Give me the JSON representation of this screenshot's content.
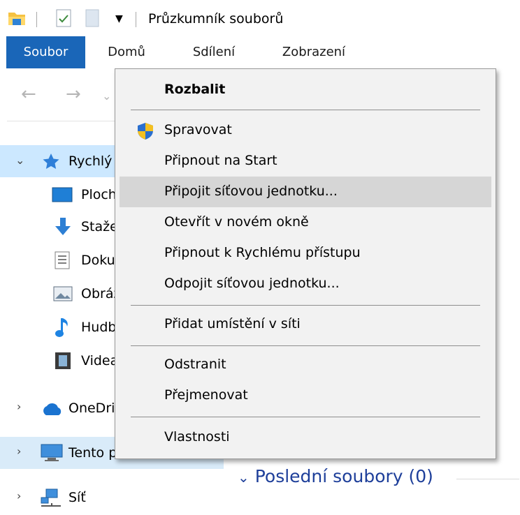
{
  "window": {
    "title": "Průzkumník souborů"
  },
  "ribbon": {
    "tabs": [
      "Soubor",
      "Domů",
      "Sdílení",
      "Zobrazení"
    ]
  },
  "sidebar": {
    "quick_access": "Rychlý přístup",
    "items": [
      "Plocha",
      "Stažené soubory",
      "Dokumenty",
      "Obrázky",
      "Hudba",
      "Videa"
    ],
    "onedrive": "OneDrive",
    "this_pc": "Tento počítač",
    "network": "Síť"
  },
  "content": {
    "recent_header": "Poslední soubory (0)"
  },
  "context_menu": {
    "items": [
      "Rozbalit",
      "Spravovat",
      "Připnout na Start",
      "Připojit síťovou jednotku...",
      "Otevřít v novém okně",
      "Připnout k Rychlému přístupu",
      "Odpojit síťovou jednotku...",
      "Přidat umístění v síti",
      "Odstranit",
      "Přejmenovat",
      "Vlastnosti"
    ],
    "highlighted_index": 3
  },
  "colors": {
    "file_tab": "#1a66b8",
    "selected_row": "#cce8ff",
    "menu_bg": "#f2f2f2",
    "menu_highlight": "#d6d6d6",
    "link_header": "#1e3f9a"
  }
}
